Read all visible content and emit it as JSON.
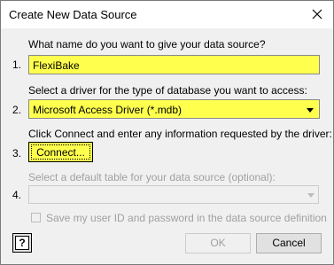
{
  "window": {
    "title": "Create New Data Source",
    "close_icon": "close-icon"
  },
  "steps": [
    {
      "number": "1.",
      "prompt": "What name do you want to give your data source?",
      "value": "FlexiBake"
    },
    {
      "number": "2.",
      "prompt": "Select a driver for the type of database you want to access:",
      "value": "Microsoft Access Driver (*.mdb)"
    },
    {
      "number": "3.",
      "prompt": "Click Connect and enter any information requested by the driver:",
      "button": "Connect..."
    },
    {
      "number": "4.",
      "prompt": "Select a default table for your data source (optional):",
      "value": ""
    }
  ],
  "save_credentials": {
    "label": "Save my user ID and password in the data source definition",
    "checked": false,
    "enabled": false
  },
  "footer": {
    "help_icon": "help-icon",
    "help_glyph": "?",
    "ok_label": "OK",
    "ok_enabled": false,
    "cancel_label": "Cancel"
  },
  "colors": {
    "highlight": "#ffff4d",
    "disabled_text": "#a0a0a0"
  }
}
